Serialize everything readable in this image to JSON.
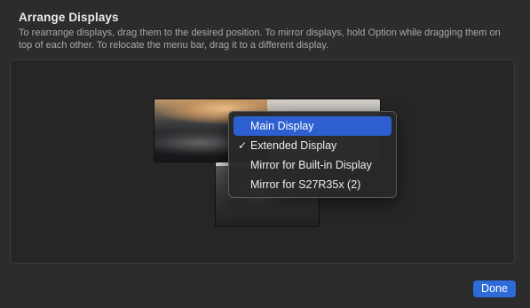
{
  "dialog": {
    "title": "Arrange Displays",
    "subtitle": "To rearrange displays, drag them to the desired position. To mirror displays, hold Option while dragging them on top of each other. To relocate the menu bar, drag it to a different display."
  },
  "displays": [
    {
      "name": "built-in-display",
      "has_menu_bar": true
    },
    {
      "name": "external-display",
      "has_menu_bar": false
    }
  ],
  "context_menu": {
    "items": [
      {
        "label": "Main Display",
        "checked": false,
        "highlighted": true,
        "check_glyph": ""
      },
      {
        "label": "Extended Display",
        "checked": true,
        "highlighted": false,
        "check_glyph": "✓"
      },
      {
        "label": "Mirror for Built-in Display",
        "checked": false,
        "highlighted": false,
        "check_glyph": ""
      },
      {
        "label": "Mirror for S27R35x (2)",
        "checked": false,
        "highlighted": false,
        "check_glyph": ""
      }
    ]
  },
  "footer": {
    "done_label": "Done"
  },
  "colors": {
    "accent": "#2d6bd8",
    "menu_highlight": "#2d5fd0",
    "background": "#2c2c2c"
  }
}
